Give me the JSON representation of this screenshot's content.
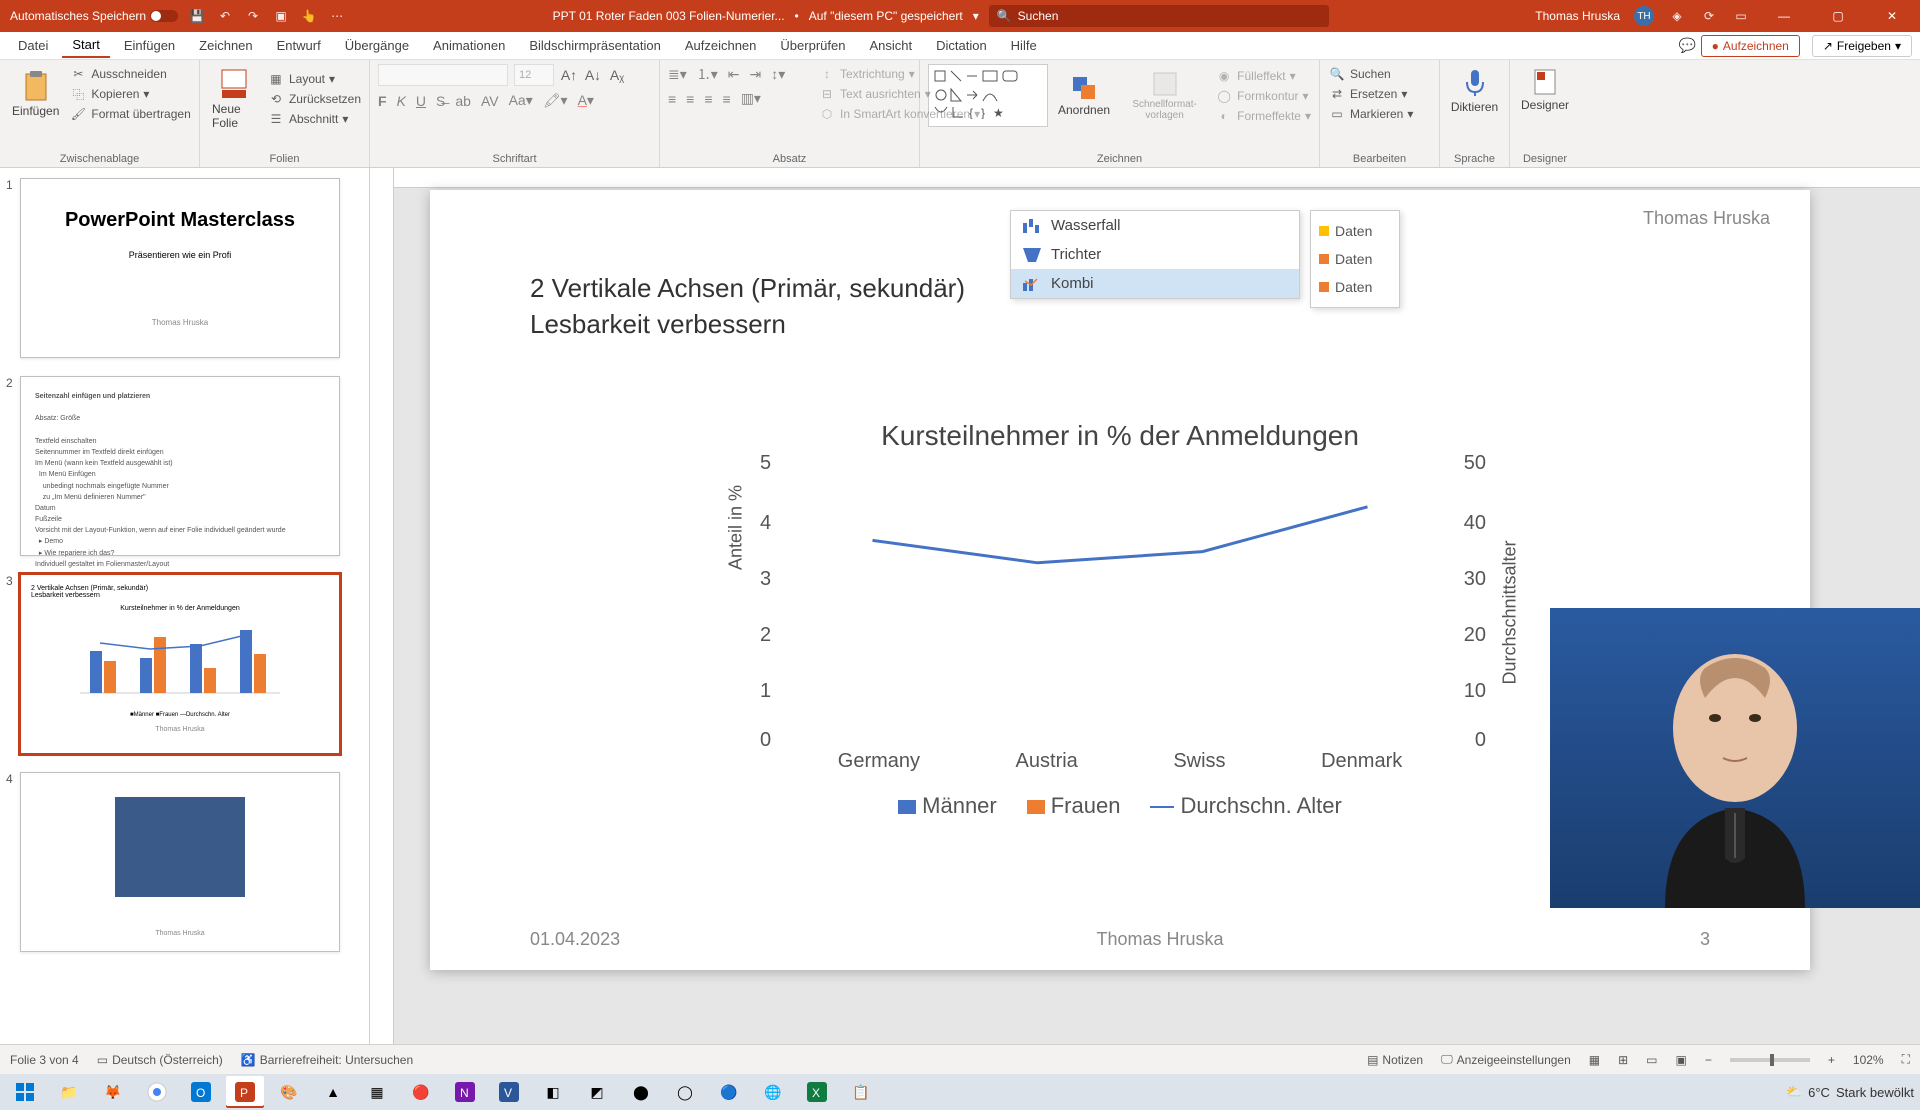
{
  "titlebar": {
    "autosave": "Automatisches Speichern",
    "filename": "PPT 01 Roter Faden 003 Folien-Numerier...",
    "saved": "Auf \"diesem PC\" gespeichert",
    "search": "Suchen",
    "user": "Thomas Hruska",
    "initials": "TH"
  },
  "tabs": [
    "Datei",
    "Start",
    "Einfügen",
    "Zeichnen",
    "Entwurf",
    "Übergänge",
    "Animationen",
    "Bildschirmpräsentation",
    "Aufzeichnen",
    "Überprüfen",
    "Ansicht",
    "Dictation",
    "Hilfe"
  ],
  "active_tab": "Start",
  "record_btn": "Aufzeichnen",
  "share_btn": "Freigeben",
  "ribbon": {
    "paste": "Einfügen",
    "cut": "Ausschneiden",
    "copy": "Kopieren",
    "format_painter": "Format übertragen",
    "g_clipboard": "Zwischenablage",
    "new_slide": "Neue Folie",
    "layout": "Layout",
    "reset": "Zurücksetzen",
    "section": "Abschnitt",
    "g_slides": "Folien",
    "fontsize": "12",
    "g_font": "Schriftart",
    "text_dir": "Textrichtung",
    "text_align": "Text ausrichten",
    "smartart": "In SmartArt konvertieren",
    "g_para": "Absatz",
    "arrange": "Anordnen",
    "quickstyles": "Schnellformat-vorlagen",
    "shape_fill": "Fülleffekt",
    "shape_outline": "Formkontur",
    "shape_effects": "Formeffekte",
    "g_draw": "Zeichnen",
    "find": "Suchen",
    "replace": "Ersetzen",
    "select": "Markieren",
    "g_edit": "Bearbeiten",
    "dictate": "Diktieren",
    "g_voice": "Sprache",
    "designer": "Designer",
    "g_designer": "Designer"
  },
  "thumbs": {
    "t1_title": "PowerPoint Masterclass",
    "t1_sub": "Präsentieren wie ein Profi",
    "t1_author": "Thomas Hruska",
    "t2_title": "Seitenzahl einfügen und platzieren",
    "t4_author": "Thomas Hruska"
  },
  "slide": {
    "author_tr": "Thomas Hruska",
    "line1": "2 Vertikale Achsen (Primär, sekundär)",
    "line2": "Lesbarkeit verbessern",
    "chtype_wasserfall": "Wasserfall",
    "chtype_trichter": "Trichter",
    "chtype_kombi": "Kombi",
    "leg_daten": "Daten",
    "date": "01.04.2023",
    "author": "Thomas Hruska",
    "page": "3"
  },
  "chart_data": {
    "type": "bar",
    "title": "Kursteilnehmer in % der Anmeldungen",
    "ylabel": "Anteil in %",
    "y2label": "Durchschnittsalter",
    "categories": [
      "Germany",
      "Austria",
      "Swiss",
      "Denmark"
    ],
    "ylim": [
      0,
      5
    ],
    "y2lim": [
      0,
      50
    ],
    "yticks": [
      0,
      1,
      2,
      3,
      4,
      5
    ],
    "y2ticks": [
      0,
      10,
      20,
      30,
      40,
      50
    ],
    "series": [
      {
        "name": "Männer",
        "values": [
          3.0,
          2.5,
          3.5,
          4.5
        ],
        "color": "#4472c4"
      },
      {
        "name": "Frauen",
        "values": [
          2.3,
          4.0,
          1.8,
          2.8
        ],
        "color": "#ed7d31"
      }
    ],
    "line_series": {
      "name": "Durchschn. Alter",
      "values": [
        36,
        32,
        34,
        42
      ],
      "color": "#4472c4"
    }
  },
  "status": {
    "slide_count": "Folie 3 von 4",
    "lang": "Deutsch (Österreich)",
    "access": "Barrierefreiheit: Untersuchen",
    "notes": "Notizen",
    "display": "Anzeigeeinstellungen",
    "zoom": "102%"
  },
  "weather": {
    "temp": "6°C",
    "desc": "Stark bewölkt"
  }
}
